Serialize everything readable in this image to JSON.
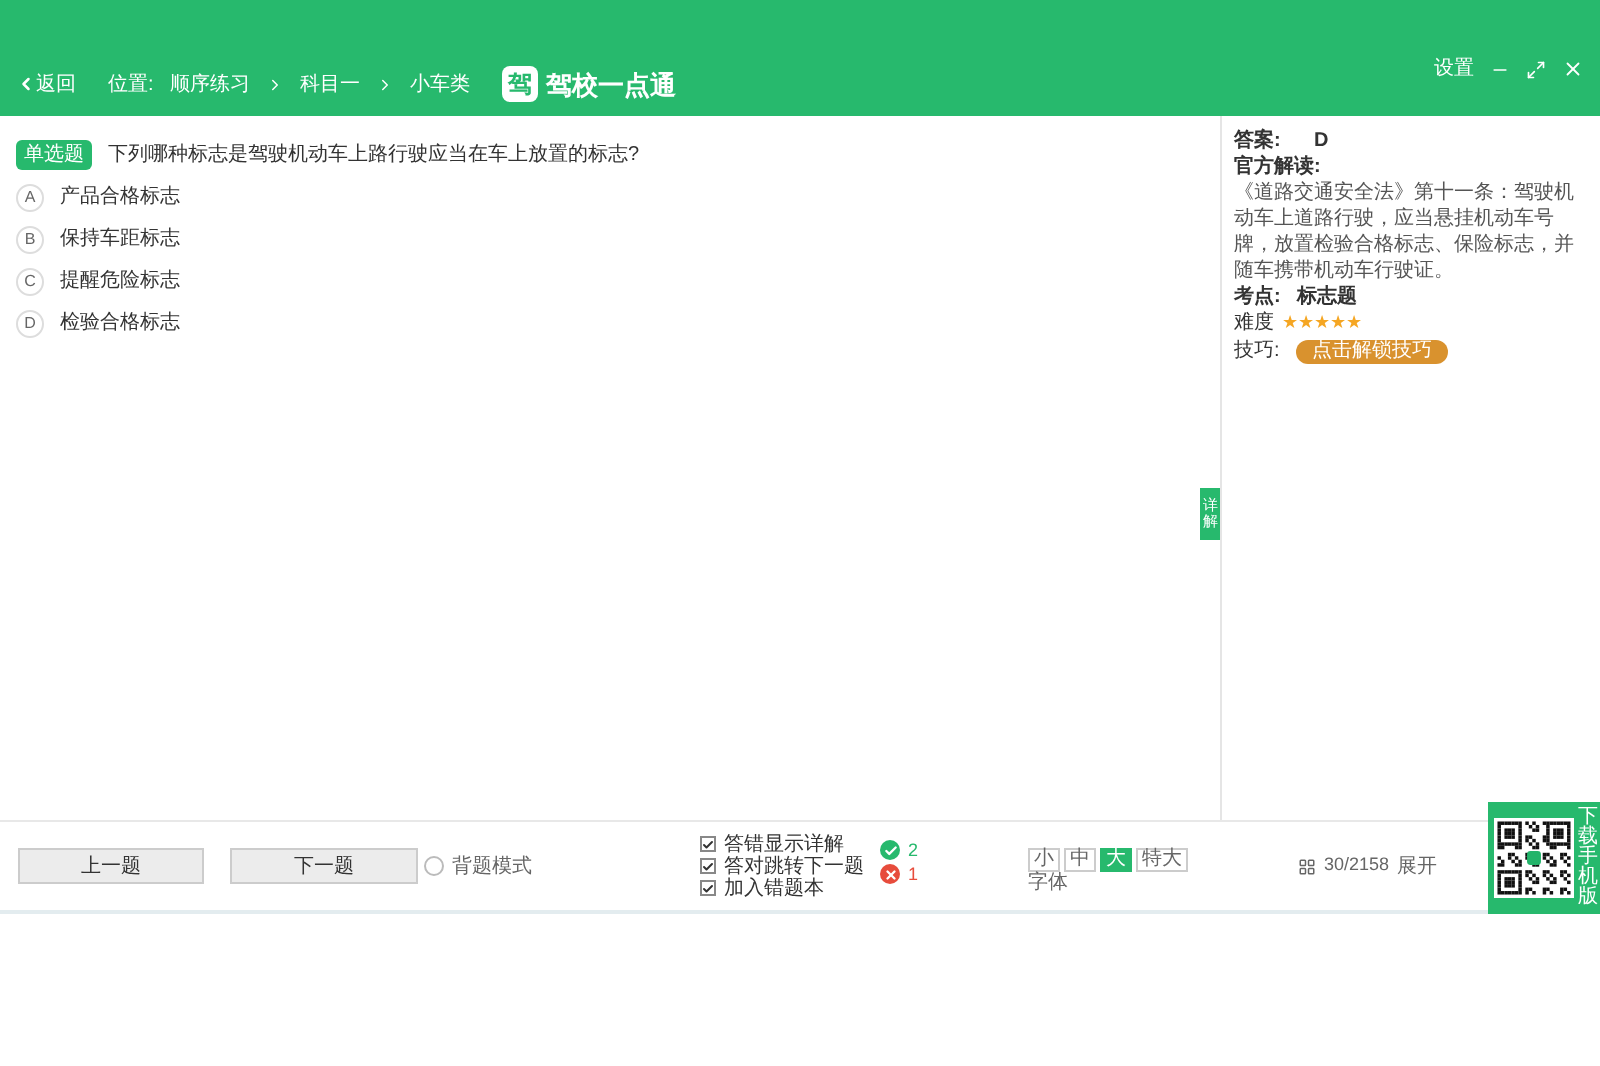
{
  "window": {
    "settings": "设置"
  },
  "nav": {
    "back": "返回",
    "location_label": "位置:",
    "breadcrumb": [
      "顺序练习",
      "科目一",
      "小车类"
    ]
  },
  "logo": {
    "mark": "驾",
    "name": "驾校一点通"
  },
  "question": {
    "type_badge": "单选题",
    "text": "下列哪种标志是驾驶机动车上路行驶应当在车上放置的标志?",
    "options": [
      {
        "letter": "A",
        "text": "产品合格标志"
      },
      {
        "letter": "B",
        "text": "保持车距标志"
      },
      {
        "letter": "C",
        "text": "提醒危险标志"
      },
      {
        "letter": "D",
        "text": "检验合格标志"
      }
    ]
  },
  "detail_tab": "详解",
  "explanation": {
    "answer_label": "答案:",
    "answer": "D",
    "official_label": "官方解读:",
    "official_text": "《道路交通安全法》第十一条：驾驶机动车上道路行驶，应当悬挂机动车号牌，放置检验合格标志、保险标志，并随车携带机动车行驶证。",
    "point_label": "考点:",
    "point": "标志题",
    "difficulty_label": "难度",
    "stars": 5,
    "tip_label": "技巧:",
    "tip_button": "点击解锁技巧"
  },
  "footer": {
    "prev": "上一题",
    "next": "下一题",
    "recite_mode": {
      "label": "背题模式",
      "checked": false
    },
    "options": [
      {
        "label": "答错显示详解",
        "checked": true
      },
      {
        "label": "答对跳转下一题",
        "checked": true
      },
      {
        "label": "加入错题本",
        "checked": true
      }
    ],
    "correct_count": "2",
    "wrong_count": "1",
    "font_sizes": [
      {
        "label": "小",
        "selected": false
      },
      {
        "label": "中",
        "selected": false
      },
      {
        "label": "大",
        "selected": true
      },
      {
        "label": "特大",
        "selected": false
      }
    ],
    "font_label": "字体",
    "progress": "30/2158",
    "expand": "展开",
    "download": "下载手机版"
  }
}
